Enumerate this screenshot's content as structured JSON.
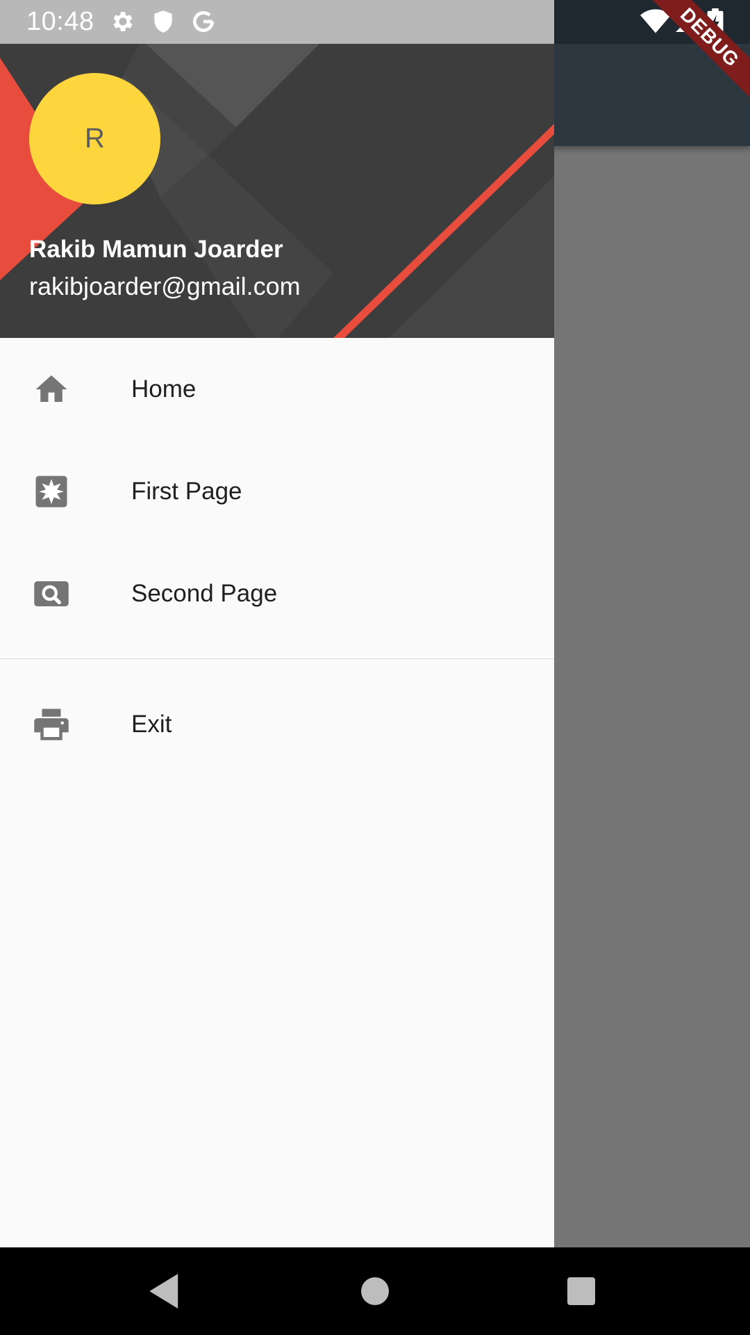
{
  "status_bar": {
    "time": "10:48",
    "left_icons": [
      "gear-icon",
      "shield-icon",
      "google-icon"
    ],
    "right_icons": [
      "wifi-icon",
      "signal-icon",
      "battery-charging-icon"
    ]
  },
  "debug_banner": {
    "label": "DEBUG",
    "color": "#7f1d1d"
  },
  "drawer": {
    "header": {
      "avatar_initial": "R",
      "avatar_color": "#fdd63d",
      "account_name": "Rakib Mamun Joarder",
      "account_email": "rakibjoarder@gmail.com"
    },
    "items": [
      {
        "label": "Home",
        "icon": "home-icon"
      },
      {
        "label": "First Page",
        "icon": "extension-icon"
      },
      {
        "label": "Second Page",
        "icon": "image-search-icon"
      }
    ],
    "footer_items": [
      {
        "label": "Exit",
        "icon": "printer-icon"
      }
    ]
  },
  "colors": {
    "accent": "#e74c3c",
    "header_bg": "#3d3d3d",
    "icon": "#757575",
    "app_bar": "#2c3740"
  },
  "nav_bar": {
    "buttons": [
      "back-icon",
      "home-circle-icon",
      "recents-icon"
    ]
  }
}
